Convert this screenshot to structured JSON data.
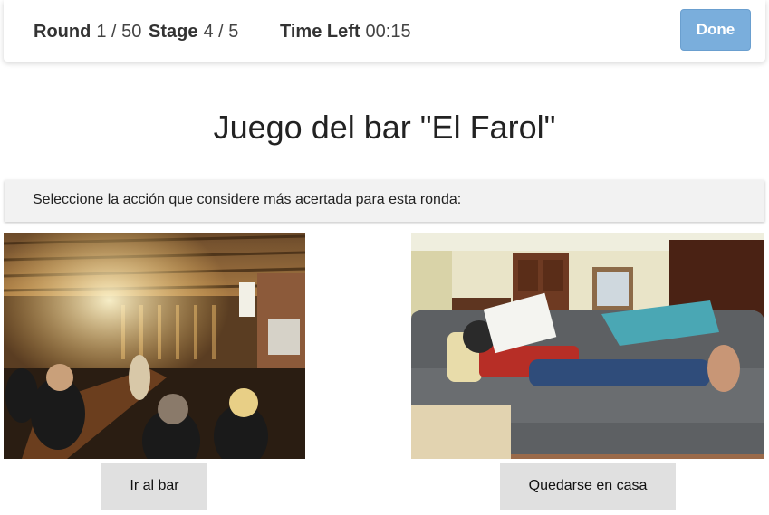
{
  "header": {
    "round_label": "Round",
    "round_value": "1 / 50",
    "stage_label": "Stage",
    "stage_value": "4 / 5",
    "time_label": "Time Left",
    "time_value": "00:15",
    "done_label": "Done"
  },
  "title": "Juego del bar \"El Farol\"",
  "prompt": "Seleccione la acción que considere más acertada para esta ronda:",
  "options": [
    {
      "image": "bar-scene-photo",
      "label": "Ir al bar"
    },
    {
      "image": "couch-reading-photo",
      "label": "Quedarse en casa"
    }
  ],
  "colors": {
    "done_button": "#7aaedc",
    "option_button": "#e0e0e0",
    "prompt_background": "#f2f2f2"
  }
}
